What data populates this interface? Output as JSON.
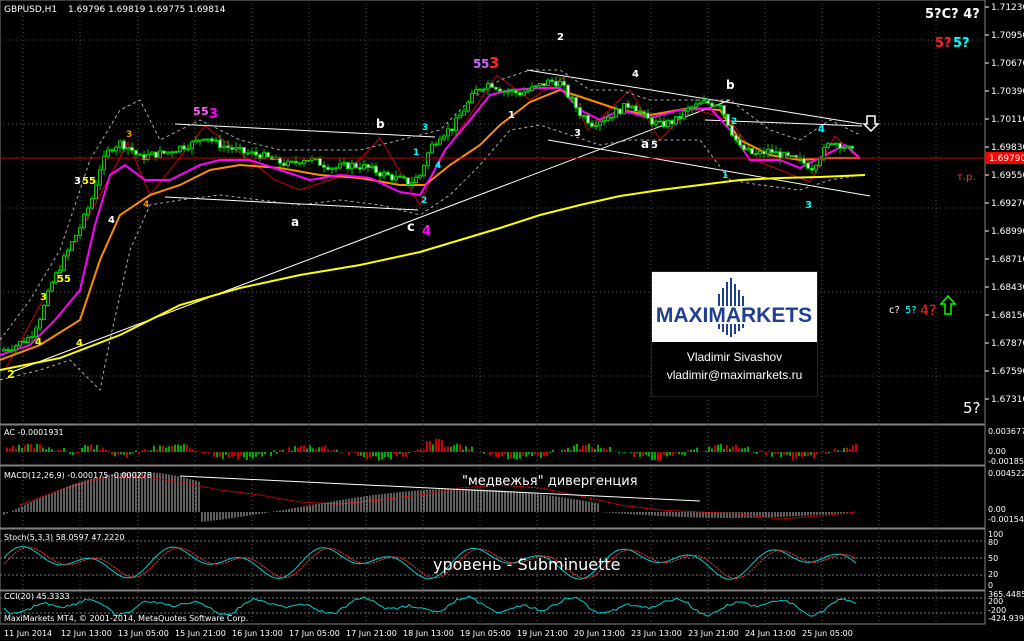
{
  "header": {
    "symbol": "GBPUSD,H1",
    "ohlc": "1.69796 1.69819 1.69775 1.69814"
  },
  "price_axis": {
    "labels": [
      "1.71230",
      "1.70950",
      "1.70670",
      "1.70390",
      "1.70110",
      "1.69830",
      "1.69550",
      "1.69270",
      "1.68990",
      "1.68710",
      "1.68430",
      "1.68150",
      "1.67870",
      "1.67590",
      "1.67310"
    ],
    "current": "1.69790",
    "current_color": "#ff0000"
  },
  "time_axis": {
    "labels": [
      "11 Jun 2014",
      "12 Jun 13:00",
      "13 Jun 05:00",
      "15 Jun 21:00",
      "16 Jun 13:00",
      "17 Jun 05:00",
      "17 Jun 21:00",
      "18 Jun 13:00",
      "19 Jun 05:00",
      "19 Jun 21:00",
      "20 Jun 13:00",
      "23 Jun 13:00",
      "23 Jun 21:00",
      "24 Jun 13:00",
      "25 Jun 05:00"
    ]
  },
  "annotations": {
    "tp": "т.р.",
    "top_right": "5?C? 4?",
    "q5a": "5?",
    "q5b": "5?",
    "right_mid_c": "c?",
    "right_mid_5": "5?",
    "right_mid_4": "4?",
    "bottom_right": "5?",
    "divergence": "\"медвежья\" дивергенция",
    "subminuette": "уровень - Subminuette"
  },
  "waves": {
    "w55a": "5",
    "w55b": "5",
    "w3a": "3",
    "w5a": "5",
    "w5b": "5",
    "w3b": "3",
    "b1": "b",
    "b2": "b",
    "a1": "a",
    "a2": "a",
    "c1": "c",
    "c4": "4",
    "n2": "2",
    "n4": "4",
    "n1": "1",
    "n3": "3",
    "n5a": "5",
    "n2b": "2",
    "l3": "3",
    "l4": "4",
    "l35": "3 5",
    "l4b": "4",
    "l2": "2",
    "l3b": "3",
    "l1": "1",
    "l4c": "4",
    "l1b": "1",
    "l1c": "1",
    "l3c": "3",
    "l4d": "4",
    "l2c": "2"
  },
  "ac": {
    "title": "AC -0.0001931",
    "levels": [
      "0.003677",
      "0.00",
      "-0.001857"
    ]
  },
  "macd": {
    "title": "MACD(12,26,9) -0.000175 -0.000278",
    "levels": [
      "0.004522",
      "0.00",
      "-0.001546"
    ]
  },
  "stoch": {
    "title": "Stoch(5,3,3) 58.0597 47.2220",
    "levels": [
      "100",
      "80",
      "50",
      "20",
      "0"
    ]
  },
  "cci": {
    "title": "CCI(20) 45.3333",
    "levels": [
      "365.4485",
      "200",
      "-200",
      "-424.9399"
    ]
  },
  "footer": "MaxiMarkets MT4, © 2001-2014, MetaQuotes Software Corp.",
  "brand": {
    "logo_text": "MAXIMARKETS",
    "name": "Vladimir Sivashov",
    "email": "vladimir@maximarkets.ru"
  },
  "chart_data": {
    "type": "candlestick",
    "symbol": "GBPUSD",
    "timeframe": "H1",
    "ylim": [
      1.6717,
      1.7127
    ],
    "current_price": 1.6979,
    "close_path": [
      [
        0,
        1.6782
      ],
      [
        16,
        1.6788
      ],
      [
        30,
        1.6796
      ],
      [
        42,
        1.682
      ],
      [
        52,
        1.685
      ],
      [
        62,
        1.687
      ],
      [
        72,
        1.689
      ],
      [
        82,
        1.691
      ],
      [
        92,
        1.6935
      ],
      [
        100,
        1.6965
      ],
      [
        110,
        1.6985
      ],
      [
        120,
        1.699
      ],
      [
        130,
        1.6985
      ],
      [
        140,
        1.6975
      ],
      [
        150,
        1.6978
      ],
      [
        165,
        1.698
      ],
      [
        180,
        1.6986
      ],
      [
        195,
        1.699
      ],
      [
        205,
        1.6998
      ],
      [
        215,
        1.699
      ],
      [
        230,
        1.6985
      ],
      [
        245,
        1.698
      ],
      [
        260,
        1.6978
      ],
      [
        275,
        1.6972
      ],
      [
        290,
        1.6968
      ],
      [
        305,
        1.6975
      ],
      [
        320,
        1.697
      ],
      [
        335,
        1.6965
      ],
      [
        350,
        1.6968
      ],
      [
        365,
        1.6966
      ],
      [
        380,
        1.696
      ],
      [
        395,
        1.6955
      ],
      [
        410,
        1.695
      ],
      [
        420,
        1.6958
      ],
      [
        430,
        1.6985
      ],
      [
        440,
        1.6998
      ],
      [
        452,
        1.7005
      ],
      [
        465,
        1.7025
      ],
      [
        478,
        1.7045
      ],
      [
        490,
        1.705
      ],
      [
        505,
        1.7042
      ],
      [
        520,
        1.704
      ],
      [
        535,
        1.7045
      ],
      [
        550,
        1.7052
      ],
      [
        560,
        1.705
      ],
      [
        570,
        1.7035
      ],
      [
        580,
        1.702
      ],
      [
        592,
        1.701
      ],
      [
        605,
        1.7015
      ],
      [
        618,
        1.7022
      ],
      [
        632,
        1.703
      ],
      [
        645,
        1.7015
      ],
      [
        660,
        1.7008
      ],
      [
        675,
        1.7012
      ],
      [
        690,
        1.7025
      ],
      [
        705,
        1.703
      ],
      [
        720,
        1.703
      ],
      [
        730,
        1.7005
      ],
      [
        740,
        1.6985
      ],
      [
        755,
        1.6978
      ],
      [
        770,
        1.6982
      ],
      [
        785,
        1.6976
      ],
      [
        800,
        1.6972
      ],
      [
        812,
        1.6966
      ],
      [
        822,
        1.698
      ],
      [
        832,
        1.6992
      ],
      [
        842,
        1.6988
      ],
      [
        852,
        1.6981
      ]
    ]
  }
}
